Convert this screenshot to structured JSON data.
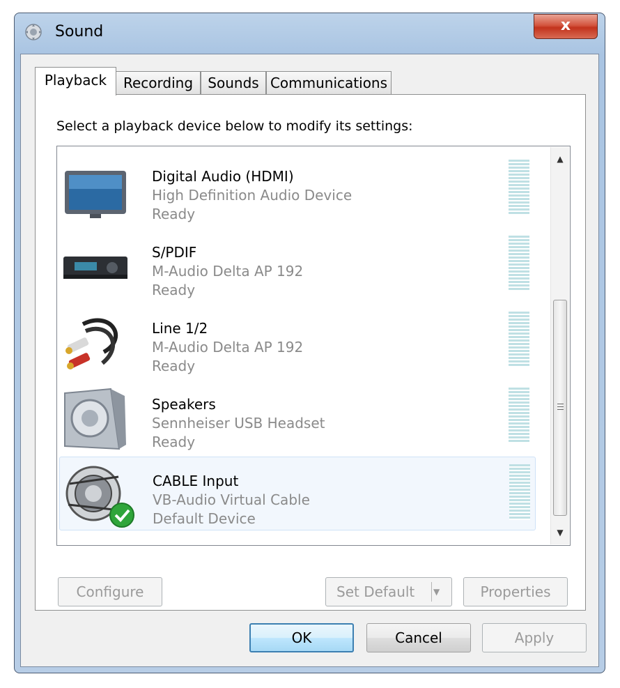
{
  "window": {
    "title": "Sound",
    "close_label": "x"
  },
  "tabs": [
    {
      "label": "Playback",
      "active": true
    },
    {
      "label": "Recording",
      "active": false
    },
    {
      "label": "Sounds",
      "active": false
    },
    {
      "label": "Communications",
      "active": false
    }
  ],
  "instruction": "Select a playback device below to modify its settings:",
  "devices": [
    {
      "name": "Digital Audio (HDMI)",
      "description": "High Definition Audio Device",
      "status": "Ready",
      "icon": "monitor-icon"
    },
    {
      "name": "S/PDIF",
      "description": "M-Audio Delta AP 192",
      "status": "Ready",
      "icon": "receiver-icon"
    },
    {
      "name": "Line 1/2",
      "description": "M-Audio Delta AP 192",
      "status": "Ready",
      "icon": "rca-cable-icon"
    },
    {
      "name": "Speakers",
      "description": "Sennheiser USB Headset",
      "status": "Ready",
      "icon": "speaker-icon"
    },
    {
      "name": "CABLE Input",
      "description": "VB-Audio Virtual Cable",
      "status": "Default Device",
      "icon": "virtual-cable-icon",
      "selected": true
    }
  ],
  "buttons": {
    "configure": "Configure",
    "set_default": "Set Default",
    "properties": "Properties",
    "ok": "OK",
    "cancel": "Cancel",
    "apply": "Apply"
  },
  "colors": {
    "accent": "#3c7fb1",
    "meter": "#bfe0e4",
    "close": "#c2331d"
  }
}
